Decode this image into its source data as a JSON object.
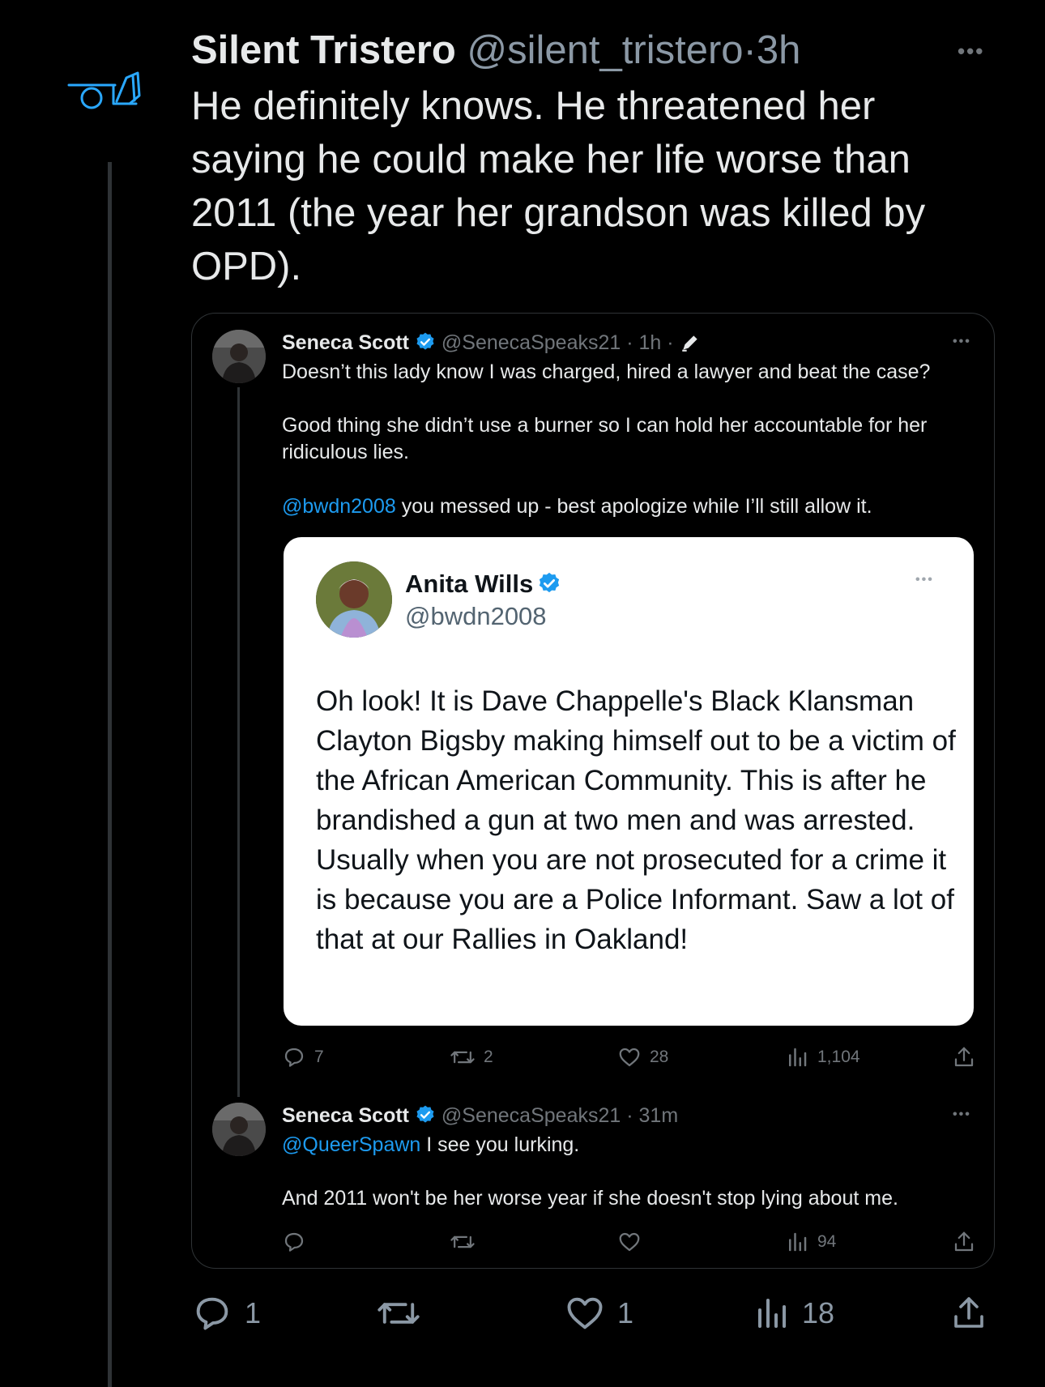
{
  "main_tweet": {
    "author_name": "Silent Tristero",
    "author_handle": "@silent_tristero",
    "separator": "·",
    "time": "3h",
    "more_label": "•••",
    "text": "He definitely knows. He threatened her saying he could make her life worse than 2011 (the year her grandson was killed by OPD).",
    "avatar_icon": "neon-logo-icon",
    "actions": {
      "replies": "1",
      "retweets": "",
      "likes": "1",
      "views": "18"
    }
  },
  "quoted_tweet_1": {
    "author_name": "Seneca Scott",
    "author_handle": "@SenecaSpeaks21",
    "time": "1h",
    "edited_icon": "pencil-icon",
    "more_label": "•••",
    "line1": "Doesn’t this lady know I was charged, hired a lawyer and beat the case?",
    "line2": "Good thing she didn’t use a burner so I can hold her accountable for her ridiculous lies.",
    "mention": "@bwdn2008",
    "line3_rest": " you messed up - best apologize while I’ll still allow it.",
    "actions": {
      "replies": "7",
      "retweets": "2",
      "likes": "28",
      "views": "1,104"
    }
  },
  "embedded_screenshot": {
    "author_name": "Anita Wills",
    "author_handle": "@bwdn2008",
    "more_label": "•••",
    "text": "Oh look! It is Dave Chappelle's Black Klansman Clayton Bigsby making himself out to be a victim of the African American Community. This is after he brandished a gun at two men and was arrested. Usually when you are not prosecuted for a crime it is because you are a Police Informant. Saw a lot of that at our Rallies in Oakland!"
  },
  "quoted_tweet_2": {
    "author_name": "Seneca Scott",
    "author_handle": "@SenecaSpeaks21",
    "time": "31m",
    "more_label": "•••",
    "mention": "@QueerSpawn",
    "line1_rest": " I see you lurking.",
    "line2": "And 2011 won't be her worse year if she doesn't stop lying about me.",
    "actions": {
      "replies": "",
      "retweets": "",
      "likes": "",
      "views": "94"
    }
  },
  "colors": {
    "background": "#000000",
    "text": "#e7e9ea",
    "muted": "#71767b",
    "link": "#1d9bf0",
    "verified": "#1d9bf0",
    "border": "#2f3336",
    "neon_logo": "#2aa8ff"
  }
}
